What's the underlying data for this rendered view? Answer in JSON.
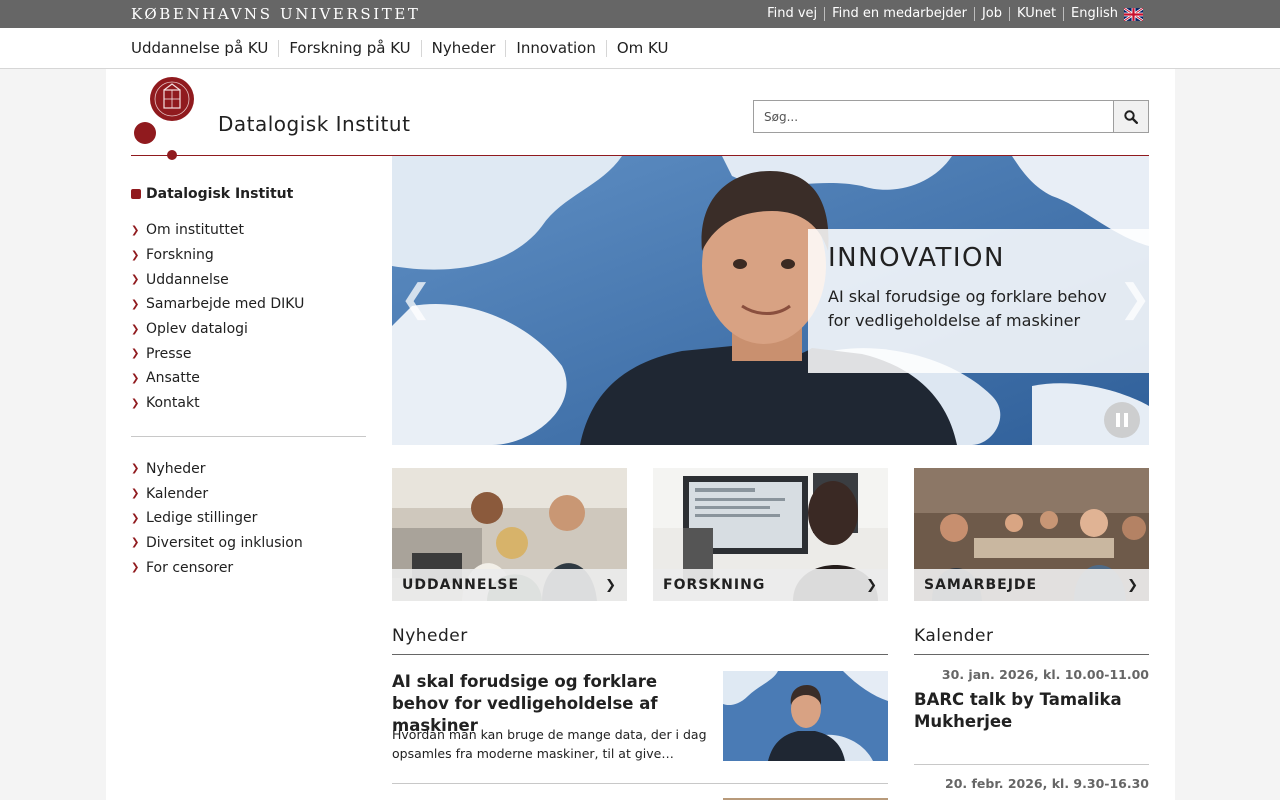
{
  "topbar": {
    "brand": "KØBENHAVNS UNIVERSITET",
    "links": [
      "Find vej",
      "Find en medarbejder",
      "Job",
      "KUnet",
      "English"
    ]
  },
  "mainnav": {
    "items": [
      "Uddannelse på KU",
      "Forskning på KU",
      "Nyheder",
      "Innovation",
      "Om KU"
    ]
  },
  "header": {
    "site_title": "Datalogisk Institut",
    "search_placeholder": "Søg..."
  },
  "sidebar": {
    "root": "Datalogisk Institut",
    "group1": [
      "Om instituttet",
      "Forskning",
      "Uddannelse",
      "Samarbejde med DIKU",
      "Oplev datalogi",
      "Presse",
      "Ansatte",
      "Kontakt"
    ],
    "group2": [
      "Nyheder",
      "Kalender",
      "Ledige stillinger",
      "Diversitet og inklusion",
      "For censorer"
    ]
  },
  "hero": {
    "kicker": "INNOVATION",
    "text": "AI skal forudsige og forklare behov for vedligeholdelse af maskiner",
    "prev": "❮",
    "next": "❯"
  },
  "tiles": [
    {
      "label": "UDDANNELSE",
      "chevron": "❯"
    },
    {
      "label": "FORSKNING",
      "chevron": "❯"
    },
    {
      "label": "SAMARBEJDE",
      "chevron": "❯"
    }
  ],
  "news": {
    "heading": "Nyheder",
    "items": [
      {
        "title": "AI skal forudsige og forklare behov for vedligeholdelse af maskiner",
        "teaser": "Hvordan man kan bruge de mange data, der i dag opsamles fra moderne maskiner, til at give…"
      }
    ]
  },
  "calendar": {
    "heading": "Kalender",
    "items": [
      {
        "date": "30. jan. 2026, kl. 10.00-11.00",
        "title": "BARC talk by Tamalika Mukherjee"
      },
      {
        "date": "20. febr. 2026, kl. 9.30-16.30",
        "title": ""
      }
    ]
  },
  "colors": {
    "ku_red": "#901a1e",
    "topbar_grey": "#666666"
  },
  "icons": {
    "search": "search-icon",
    "pause": "pause-icon",
    "flag": "uk-flag-icon",
    "logo": "ku-seal-logo"
  }
}
